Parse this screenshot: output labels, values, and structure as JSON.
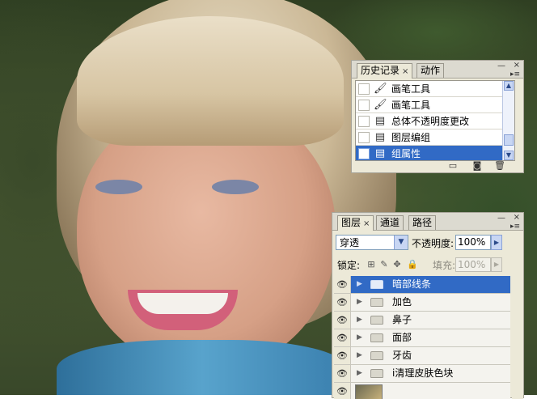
{
  "history_panel": {
    "tabs": [
      {
        "label": "历史记录",
        "close": "×",
        "active": true
      },
      {
        "label": "动作",
        "active": false
      }
    ],
    "window_buttons": {
      "minimize": "—",
      "close": "×"
    },
    "items": [
      {
        "label": "画笔工具",
        "icon": "brush-icon",
        "selected": false
      },
      {
        "label": "画笔工具",
        "icon": "brush-icon",
        "selected": false
      },
      {
        "label": "总体不透明度更改",
        "icon": "document-icon",
        "selected": false
      },
      {
        "label": "图层编组",
        "icon": "document-icon",
        "selected": false
      },
      {
        "label": "组属性",
        "icon": "document-icon",
        "selected": true
      }
    ],
    "footer_icons": [
      "new-document-from-state-icon",
      "camera-snapshot-icon",
      "trash-icon"
    ]
  },
  "layers_panel": {
    "tabs": [
      {
        "label": "图层",
        "close": "×",
        "active": true
      },
      {
        "label": "通道",
        "active": false
      },
      {
        "label": "路径",
        "active": false
      }
    ],
    "window_buttons": {
      "minimize": "—",
      "close": "×"
    },
    "blend_mode": "穿透",
    "opacity_label": "不透明度:",
    "opacity_value": "100%",
    "lock_label": "锁定:",
    "fill_label": "填充:",
    "fill_value": "100%",
    "layers": [
      {
        "name": "暗部线条",
        "selected": true
      },
      {
        "name": "加色",
        "selected": false
      },
      {
        "name": "鼻子",
        "selected": false
      },
      {
        "name": "面部",
        "selected": false
      },
      {
        "name": "牙齿",
        "selected": false
      },
      {
        "name": "i清理皮肤色块",
        "selected": false
      }
    ]
  },
  "colors": {
    "selection": "#316ac5",
    "panel_bg": "#ece9d8"
  }
}
